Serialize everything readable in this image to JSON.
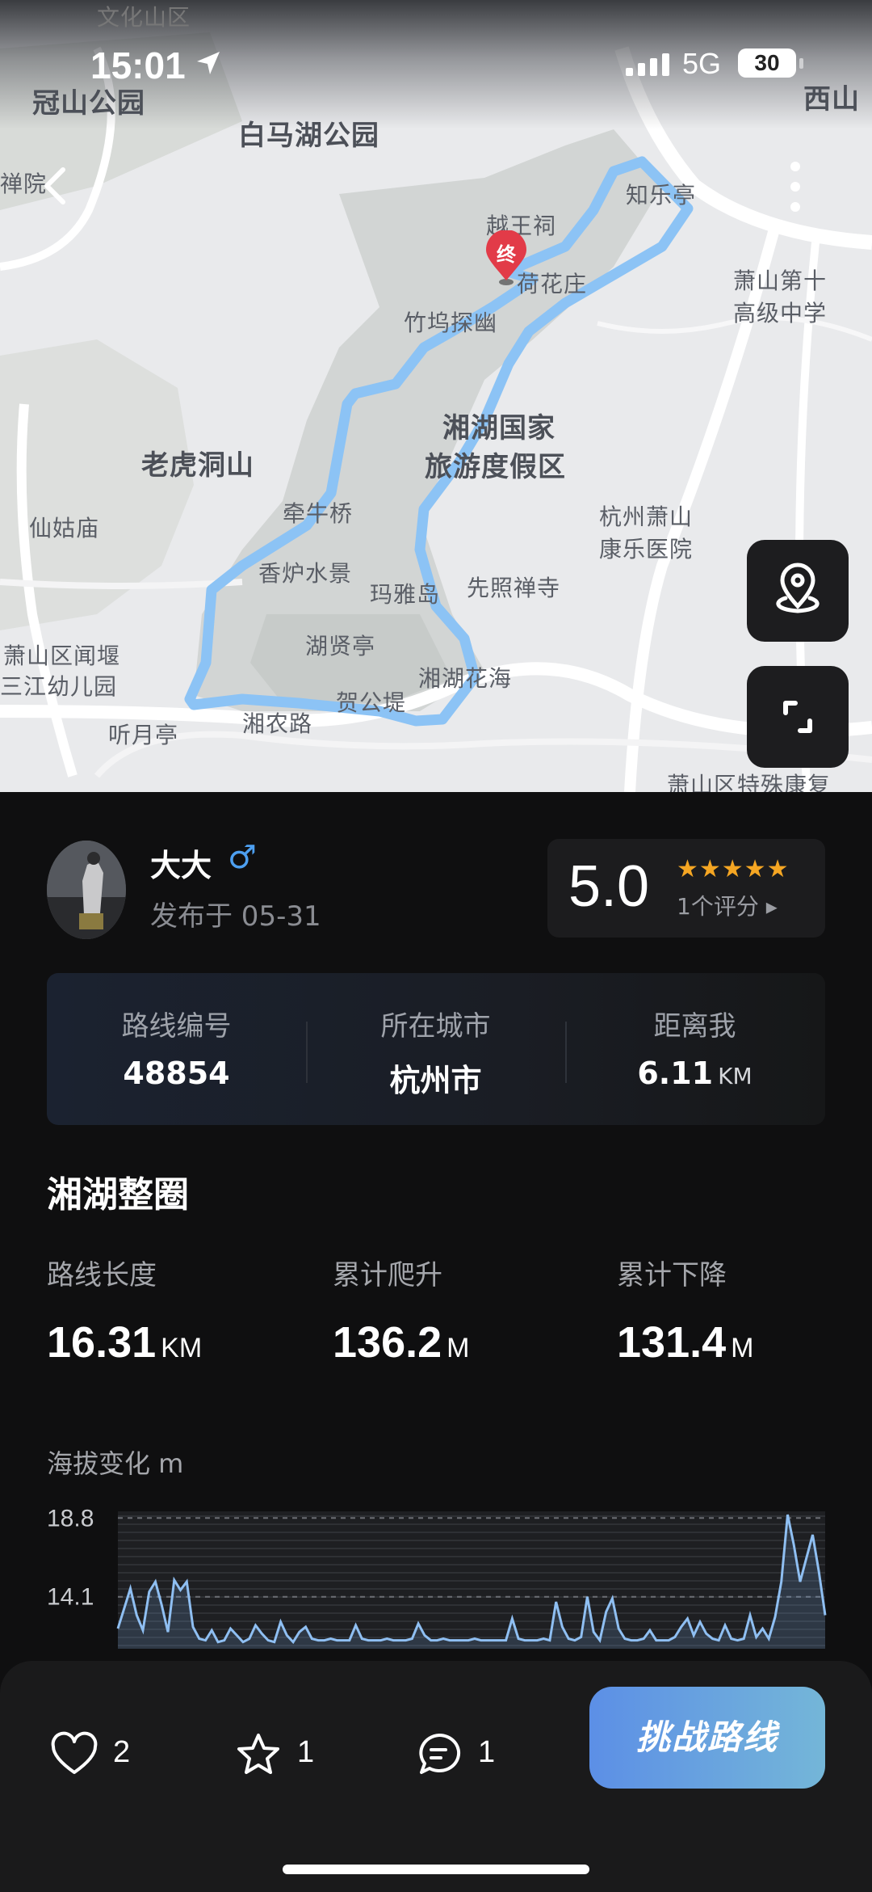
{
  "status_bar": {
    "time": "15:01",
    "network": "5G",
    "battery": "30"
  },
  "map": {
    "labels": {
      "guanshan": "冠山公园",
      "baima": "白马湖公园",
      "chan": "禅院",
      "xishan": "西山",
      "zhile": "知乐亭",
      "yuewang": "越王祠",
      "hehua": "荷花庄",
      "zhuwu": "竹坞探幽",
      "xiaoshan10_1": "萧山第十",
      "xiaoshan10_2": "高级中学",
      "xianghu_1": "湘湖国家",
      "xianghu_2": "旅游度假区",
      "laohu": "老虎洞山",
      "qianniu": "牵牛桥",
      "xiangu": "仙姑庙",
      "hangzhou_hosp_1": "杭州萧山",
      "hangzhou_hosp_2": "康乐医院",
      "xianglu": "香炉水景",
      "maya": "玛雅岛",
      "xianzhao": "先照禅寺",
      "huxian": "湖贤亭",
      "xiaoshan_kg_1": "萧山区闻堰",
      "xiaoshan_kg_2": "三江幼儿园",
      "xianghu_huahai": "湘湖花海",
      "hegong": "贺公堤",
      "tingyue": "听月亭",
      "xiangnong": "湘农路",
      "special": "萧山区特殊康复",
      "top_cut": "文化山区"
    },
    "end_marker_label": "终",
    "route_color": "#8cc3f5"
  },
  "author": {
    "name": "大大",
    "gender_symbol": "♂",
    "published": "发布于 05-31"
  },
  "rating": {
    "score": "5.0",
    "stars": "★★★★★",
    "count": "1个评分 ▸"
  },
  "info": {
    "route_id_label": "路线编号",
    "route_id": "48854",
    "city_label": "所在城市",
    "city": "杭州市",
    "distance_label": "距离我",
    "distance": "6.11",
    "distance_unit": "KM"
  },
  "route_name": "湘湖整圈",
  "stats": {
    "length_label": "路线长度",
    "length": "16.31",
    "length_unit": "KM",
    "ascent_label": "累计爬升",
    "ascent": "136.2",
    "ascent_unit": "M",
    "descent_label": "累计下降",
    "descent": "131.4",
    "descent_unit": "M"
  },
  "elevation": {
    "title": "海拔变化 m",
    "tick_labels": [
      "18.8",
      "14.1"
    ]
  },
  "chart_data": {
    "type": "area",
    "title": "海拔变化 m",
    "ylabel": "m",
    "y_ticks": [
      18.8,
      14.1
    ],
    "ylim": [
      11.0,
      19.2
    ],
    "values": [
      12.2,
      13.4,
      14.6,
      13.0,
      12.1,
      14.4,
      15.0,
      13.6,
      12.0,
      15.1,
      14.5,
      15.0,
      12.3,
      11.6,
      11.5,
      12.1,
      11.4,
      11.5,
      12.2,
      11.8,
      11.4,
      11.6,
      12.4,
      11.9,
      11.5,
      11.4,
      12.6,
      11.8,
      11.4,
      12.0,
      12.3,
      11.6,
      11.5,
      11.5,
      11.6,
      11.5,
      11.5,
      11.5,
      12.4,
      11.6,
      11.5,
      11.5,
      11.5,
      11.6,
      11.5,
      11.5,
      11.5,
      11.6,
      12.5,
      11.8,
      11.5,
      11.5,
      11.6,
      11.5,
      11.5,
      11.5,
      11.5,
      11.6,
      11.5,
      11.5,
      11.5,
      11.5,
      11.5,
      12.8,
      11.6,
      11.5,
      11.5,
      11.5,
      11.6,
      11.5,
      13.8,
      12.3,
      11.6,
      11.5,
      11.7,
      14.1,
      12.0,
      11.5,
      13.2,
      14.0,
      12.2,
      11.6,
      11.5,
      11.5,
      11.6,
      12.1,
      11.5,
      11.5,
      11.5,
      11.7,
      12.3,
      12.8,
      11.8,
      12.6,
      11.9,
      11.6,
      11.5,
      12.4,
      11.6,
      11.5,
      11.6,
      13.0,
      11.7,
      12.2,
      11.6,
      12.9,
      15.0,
      19.0,
      17.2,
      15.0,
      16.4,
      17.8,
      15.6,
      13.0
    ],
    "x": [],
    "xlabel": ""
  },
  "actions": {
    "like_count": "2",
    "fav_count": "1",
    "comment_count": "1",
    "challenge_label": "挑战路线"
  }
}
